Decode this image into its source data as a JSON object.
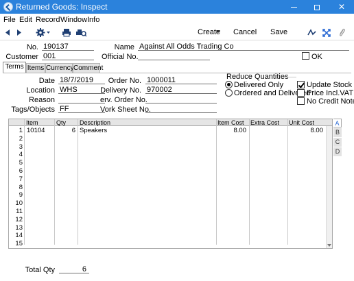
{
  "window": {
    "title": "Returned Goods: Inspect",
    "controls": [
      "—",
      "□",
      "✕"
    ]
  },
  "menu": [
    "File",
    "Edit",
    "Record",
    "Window",
    "Info"
  ],
  "toolbar": {
    "create": "Create",
    "cancel": "Cancel",
    "save": "Save"
  },
  "header": {
    "no_label": "No.",
    "no_value": "190137",
    "name_label": "Name",
    "name_value": "Against All Odds Trading Co",
    "customer_label": "Customer",
    "customer_value": "001",
    "official_label": "Official No.",
    "official_value": "",
    "ok_label": "OK"
  },
  "tabs": [
    "Terms",
    "Items",
    "Currency",
    "Comment"
  ],
  "terms": {
    "date_label": "Date",
    "date_value": "18/7/2019",
    "location_label": "Location",
    "location_value": "WHS",
    "reason_label": "Reason",
    "reason_value": "",
    "tags_label": "Tags/Objects",
    "tags_value": "FF",
    "order_label": "Order No.",
    "order_value": "1000011",
    "delivery_label": "Delivery No.",
    "delivery_value": "970002",
    "serv_order_label": "erv. Order No.",
    "serv_order_value": "",
    "work_sheet_label": "Vork Sheet No.",
    "work_sheet_value": ""
  },
  "reduce": {
    "title": "Reduce Quantities",
    "options": [
      "Delivered Only",
      "Ordered and Delivered"
    ],
    "selected": "Delivered Only"
  },
  "checks": {
    "update_stock": "Update Stock",
    "price_incl_vat": "Price Incl.VAT",
    "no_credit_notes": "No Credit Notes"
  },
  "grid": {
    "headers": [
      "Item",
      "Qty",
      "Description",
      "Item Cost",
      "Extra Cost",
      "Unit Cost"
    ],
    "rows": [
      {
        "n": "1",
        "item": "10104",
        "qty": "6",
        "desc": "Speakers",
        "item_cost": "8.00",
        "extra_cost": "",
        "unit_cost": "8.00"
      },
      {
        "n": "2",
        "item": "",
        "qty": "",
        "desc": "",
        "item_cost": "",
        "extra_cost": "",
        "unit_cost": ""
      },
      {
        "n": "3",
        "item": "",
        "qty": "",
        "desc": "",
        "item_cost": "",
        "extra_cost": "",
        "unit_cost": ""
      },
      {
        "n": "4",
        "item": "",
        "qty": "",
        "desc": "",
        "item_cost": "",
        "extra_cost": "",
        "unit_cost": ""
      },
      {
        "n": "5",
        "item": "",
        "qty": "",
        "desc": "",
        "item_cost": "",
        "extra_cost": "",
        "unit_cost": ""
      },
      {
        "n": "6",
        "item": "",
        "qty": "",
        "desc": "",
        "item_cost": "",
        "extra_cost": "",
        "unit_cost": ""
      },
      {
        "n": "7",
        "item": "",
        "qty": "",
        "desc": "",
        "item_cost": "",
        "extra_cost": "",
        "unit_cost": ""
      },
      {
        "n": "8",
        "item": "",
        "qty": "",
        "desc": "",
        "item_cost": "",
        "extra_cost": "",
        "unit_cost": ""
      },
      {
        "n": "9",
        "item": "",
        "qty": "",
        "desc": "",
        "item_cost": "",
        "extra_cost": "",
        "unit_cost": ""
      },
      {
        "n": "10",
        "item": "",
        "qty": "",
        "desc": "",
        "item_cost": "",
        "extra_cost": "",
        "unit_cost": ""
      },
      {
        "n": "11",
        "item": "",
        "qty": "",
        "desc": "",
        "item_cost": "",
        "extra_cost": "",
        "unit_cost": ""
      },
      {
        "n": "12",
        "item": "",
        "qty": "",
        "desc": "",
        "item_cost": "",
        "extra_cost": "",
        "unit_cost": ""
      },
      {
        "n": "13",
        "item": "",
        "qty": "",
        "desc": "",
        "item_cost": "",
        "extra_cost": "",
        "unit_cost": ""
      },
      {
        "n": "14",
        "item": "",
        "qty": "",
        "desc": "",
        "item_cost": "",
        "extra_cost": "",
        "unit_cost": ""
      },
      {
        "n": "15",
        "item": "",
        "qty": "",
        "desc": "",
        "item_cost": "",
        "extra_cost": "",
        "unit_cost": ""
      }
    ],
    "side_tabs": [
      "A",
      "B",
      "C",
      "D"
    ]
  },
  "footer": {
    "total_qty_label": "Total Qty",
    "total_qty_value": "6"
  },
  "colors": {
    "titlebar": "#2b82dc",
    "accent": "#2b6ad4"
  }
}
